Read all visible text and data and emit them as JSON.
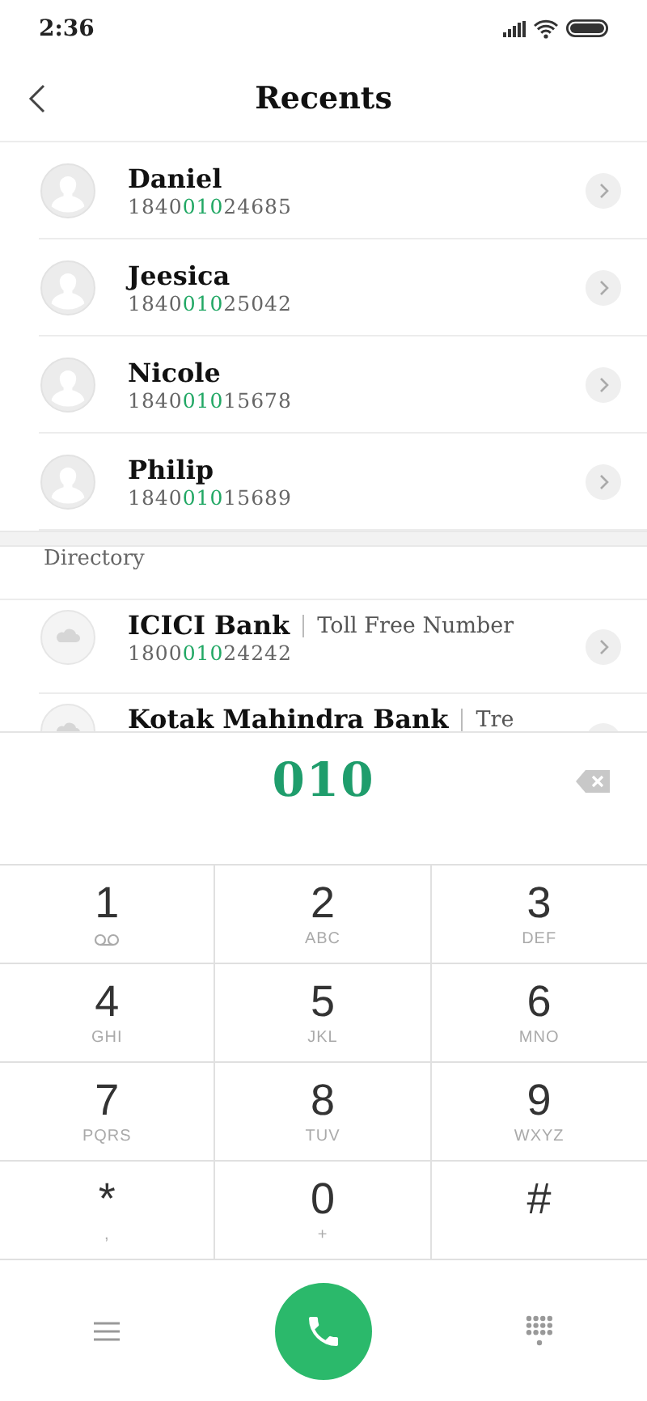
{
  "status_bar": {
    "time": "2:36"
  },
  "header": {
    "title": "Recents"
  },
  "recents": [
    {
      "name": "Daniel",
      "number": [
        {
          "text": "1840",
          "match": false
        },
        {
          "text": "010",
          "match": true
        },
        {
          "text": "24685",
          "match": false
        }
      ]
    },
    {
      "name": "Jeesica",
      "number": [
        {
          "text": "1840",
          "match": false
        },
        {
          "text": "010",
          "match": true
        },
        {
          "text": "25042",
          "match": false
        }
      ]
    },
    {
      "name": "Nicole",
      "number": [
        {
          "text": "1840",
          "match": false
        },
        {
          "text": "010",
          "match": true
        },
        {
          "text": "15678",
          "match": false
        }
      ]
    },
    {
      "name": "Philip",
      "number": [
        {
          "text": "1840",
          "match": false
        },
        {
          "text": "010",
          "match": true
        },
        {
          "text": "15689",
          "match": false
        }
      ]
    }
  ],
  "directory": {
    "title": "Directory",
    "items": [
      {
        "name": "ICICI Bank",
        "detail": "Toll Free Number",
        "number": [
          {
            "text": "1800",
            "match": false
          },
          {
            "text": "010",
            "match": true
          },
          {
            "text": "24242",
            "match": false
          }
        ]
      },
      {
        "name": "Kotak Mahindra Bank",
        "detail": "Tre"
      }
    ]
  },
  "dialer": {
    "input": "010",
    "keys": [
      {
        "digit": "1",
        "kind": "voicemail"
      },
      {
        "digit": "2",
        "kind": "letters",
        "letters": "ABC"
      },
      {
        "digit": "3",
        "kind": "letters",
        "letters": "DEF"
      },
      {
        "digit": "4",
        "kind": "letters",
        "letters": "GHI"
      },
      {
        "digit": "5",
        "kind": "letters",
        "letters": "JKL"
      },
      {
        "digit": "6",
        "kind": "letters",
        "letters": "MNO"
      },
      {
        "digit": "7",
        "kind": "letters",
        "letters": "PQRS"
      },
      {
        "digit": "8",
        "kind": "letters",
        "letters": "TUV"
      },
      {
        "digit": "9",
        "kind": "letters",
        "letters": "WXYZ"
      },
      {
        "digit": "*",
        "kind": "letters",
        "letters": ","
      },
      {
        "digit": "0",
        "kind": "letters",
        "letters": "+"
      },
      {
        "digit": "#",
        "kind": "letters"
      }
    ]
  }
}
